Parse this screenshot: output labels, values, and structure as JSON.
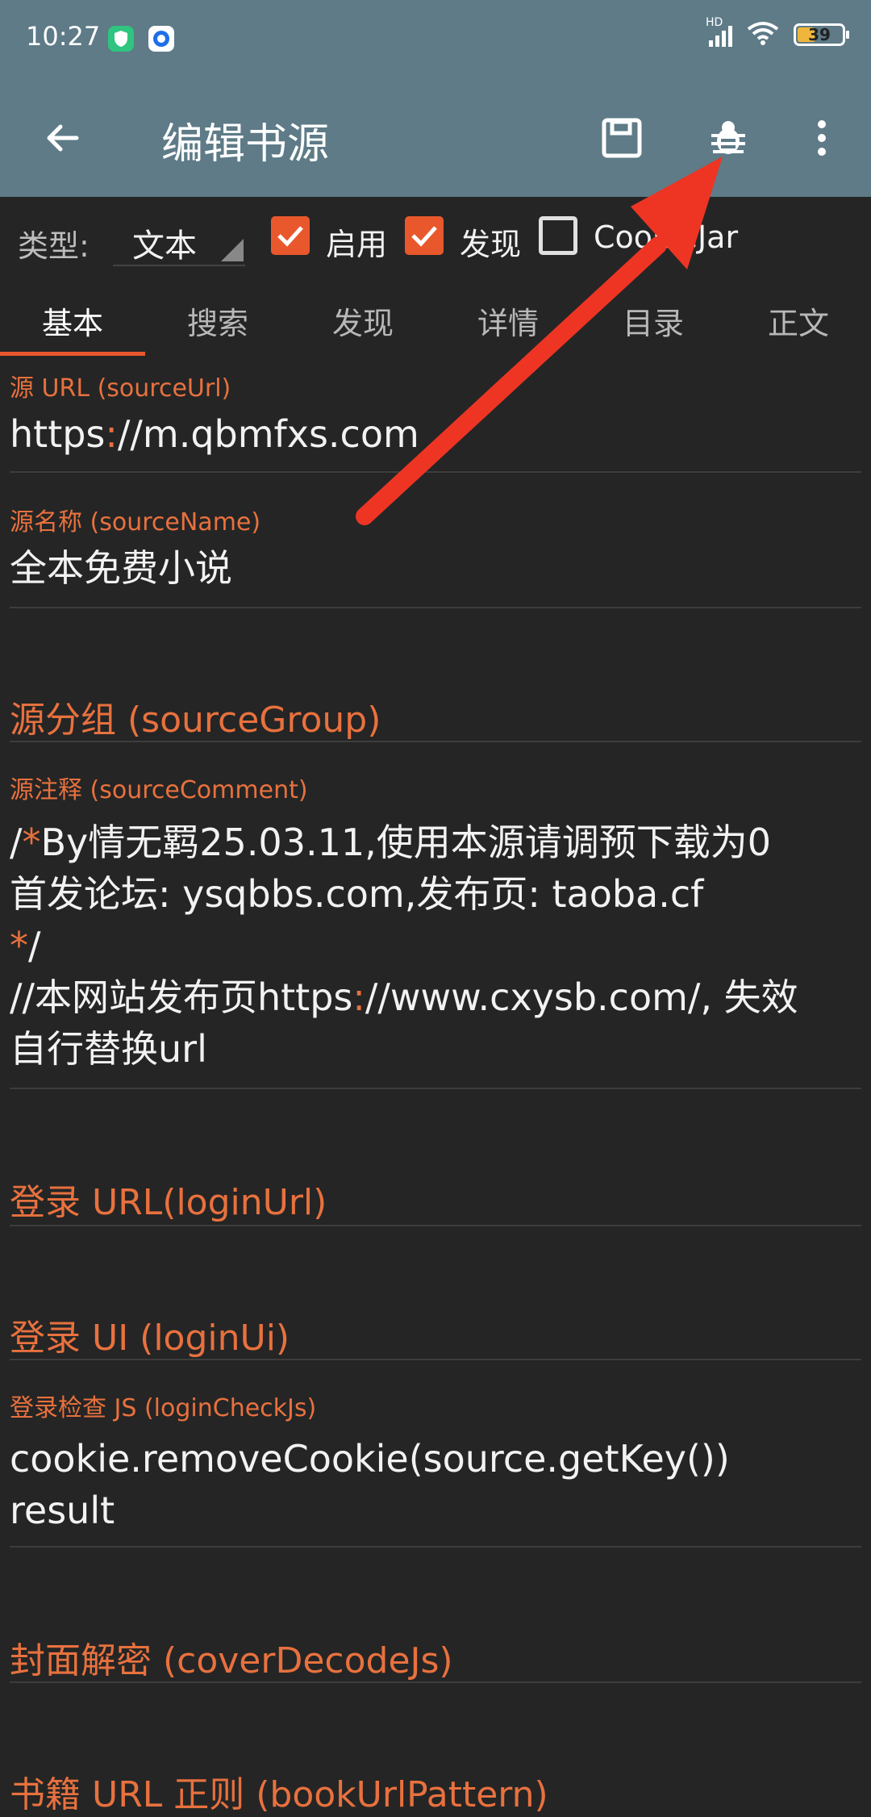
{
  "status_bar": {
    "time": "10:27",
    "battery": "39",
    "network": "HD"
  },
  "toolbar": {
    "back_icon": "arrow-left-icon",
    "title": "编辑书源",
    "save_icon": "save-icon",
    "debug_icon": "bug-icon",
    "more_icon": "more-vert-icon"
  },
  "options": {
    "type_label": "类型:",
    "type_value": "文本",
    "enabled_label": "启用",
    "enabled_checked": true,
    "discover_label": "发现",
    "discover_checked": true,
    "cookiejar_label": "CookieJar",
    "cookiejar_checked": false
  },
  "tabs": [
    {
      "label": "基本",
      "active": true
    },
    {
      "label": "搜索",
      "active": false
    },
    {
      "label": "发现",
      "active": false
    },
    {
      "label": "详情",
      "active": false
    },
    {
      "label": "目录",
      "active": false
    },
    {
      "label": "正文",
      "active": false
    }
  ],
  "fields": {
    "source_url": {
      "label": "源 URL (sourceUrl)",
      "value_prefix": "https",
      "value_colon": ":",
      "value_rest": "//m.qbmfxs.com"
    },
    "source_name": {
      "label": "源名称 (sourceName)",
      "value": "全本免费小说"
    },
    "source_group": {
      "hint": "源分组 (sourceGroup)"
    },
    "source_comment": {
      "label": "源注释 (sourceComment)",
      "line1_a": "/",
      "line1_b": "*",
      "line1_c": "By情无羁25.03.11,使用本源请调预下载为0",
      "line2": "首发论坛: ysqbbs.com,发布页: taoba.cf",
      "line3_a": "*",
      "line3_b": "/",
      "line4_a": "//本网站发布页https",
      "line4_b": ":",
      "line4_c": "//www.cxysb.com/, 失效",
      "line5": "自行替换url"
    },
    "login_url": {
      "hint": "登录 URL(loginUrl)"
    },
    "login_ui": {
      "hint": "登录 UI (loginUi)"
    },
    "login_check_js": {
      "label": "登录检查 JS (loginCheckJs)",
      "line1": "cookie.removeCookie(source.getKey())",
      "line2": "result"
    },
    "cover_decode_js": {
      "hint": "封面解密 (coverDecodeJs)"
    },
    "book_url_pattern": {
      "hint": "书籍 URL 正则 (bookUrlPattern)"
    }
  },
  "colors": {
    "toolbar": "#5e7b87",
    "accent": "#e8582c",
    "background": "#252525",
    "annotation_arrow": "#ee3524"
  }
}
